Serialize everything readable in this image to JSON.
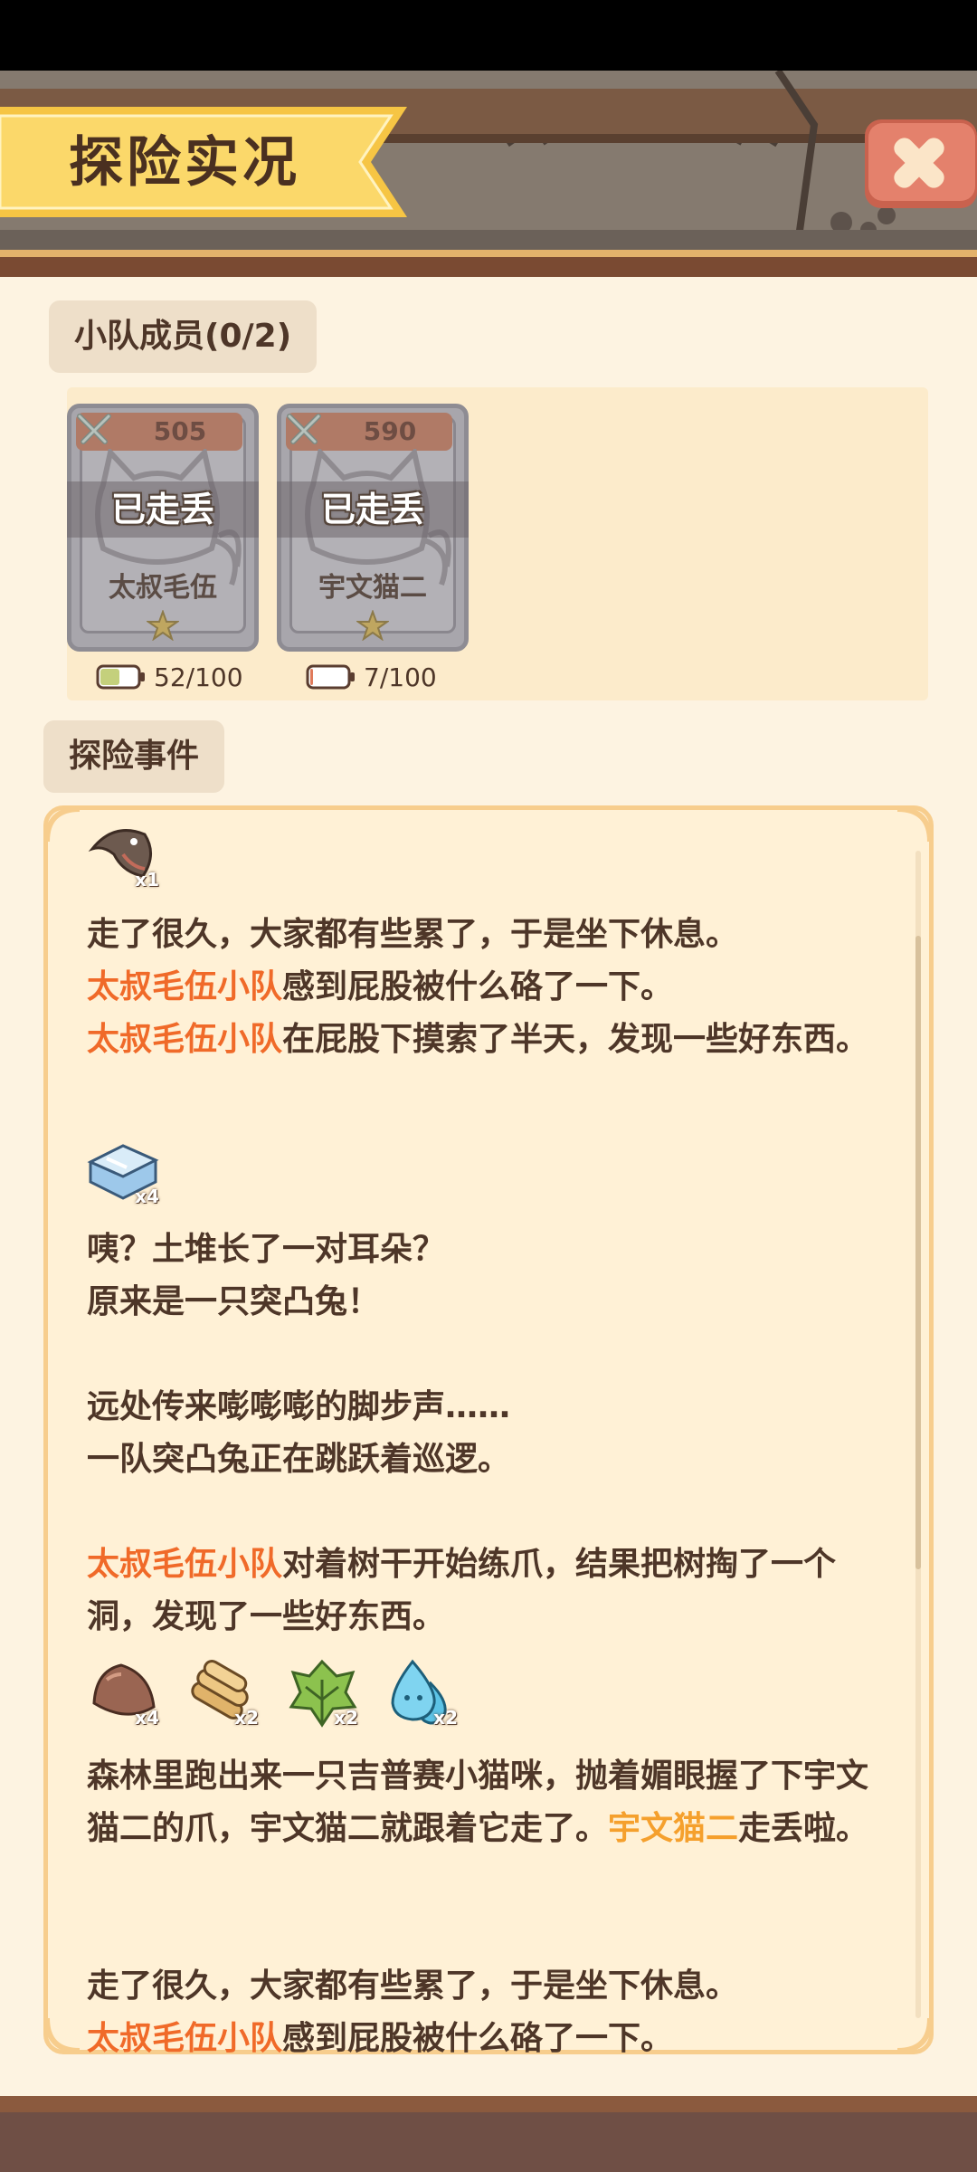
{
  "header": {
    "title": "探险实况"
  },
  "team": {
    "tab_label": "小队成员(0/2)",
    "members": [
      {
        "power": "505",
        "status": "已走丢",
        "name": "太叔毛伍",
        "energy": "52/100",
        "energy_level": 0.52
      },
      {
        "power": "590",
        "status": "已走丢",
        "name": "宇文猫二",
        "energy": "7/100",
        "energy_level": 0.07
      }
    ]
  },
  "events": {
    "tab_label": "探险事件",
    "items": {
      "fish_qty": "x1",
      "ice_qty": "x4",
      "chestnut_qty": "x4",
      "wood_qty": "x2",
      "leaf_qty": "x2",
      "water_qty": "x2"
    },
    "log": {
      "p1_line1": "走了很久，大家都有些累了，于是坐下休息。",
      "p1_team": "太叔毛伍小队",
      "p1_line2": "感到屁股被什么硌了一下。",
      "p1_team2": "太叔毛伍小队",
      "p1_line3": "在屁股下摸索了半天，发现一些好东西。",
      "p2_line1": "咦？土堆长了一对耳朵？",
      "p2_line2": "原来是一只突凸兔！",
      "p3_line1": "远处传来嘭嘭嘭的脚步声……",
      "p3_line2": "一队突凸兔正在跳跃着巡逻。",
      "p4_team": "太叔毛伍小队",
      "p4_line1": "对着树干开始练爪，结果把树掏了一个洞，发现了一些好东西。",
      "p5_line1": "森林里跑出来一只吉普赛小猫咪，抛着媚眼握了下宇文猫二的爪，宇文猫二就跟着它走了。",
      "p5_cat": "宇文猫二",
      "p5_line2": "走丢啦。",
      "p6_line1": "走了很久，大家都有些累了，于是坐下休息。",
      "p6_team": "太叔毛伍小队",
      "p6_line2": "感到屁股被什么硌了一下。"
    }
  },
  "colors": {
    "highlight_team": "#f06a29",
    "highlight_cat": "#f5a02d",
    "panel_bg": "#fff1d6",
    "panel_border": "#f7cd8d"
  }
}
